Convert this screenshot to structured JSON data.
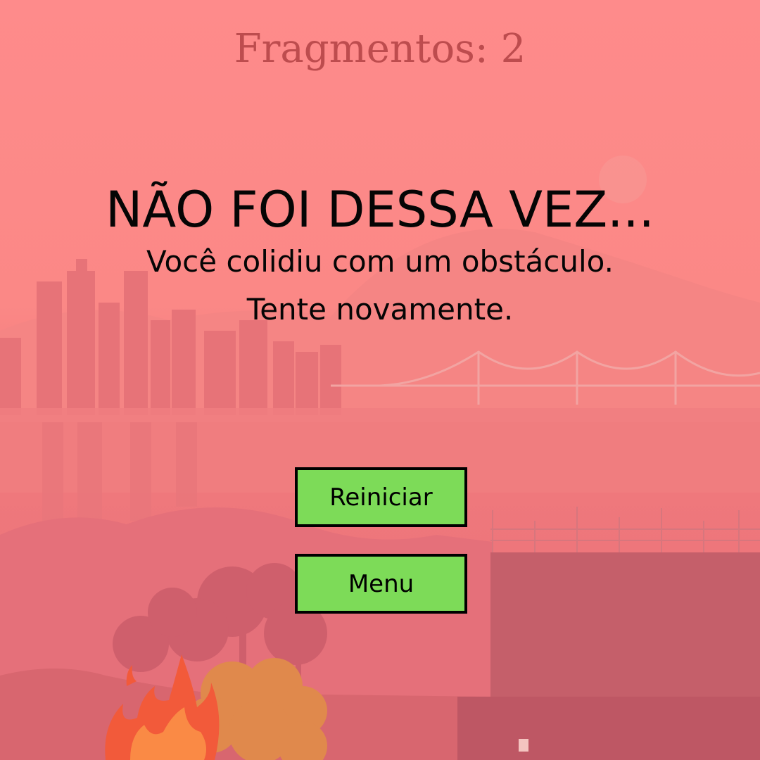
{
  "hud": {
    "fragments_text": "Fragmentos: 2"
  },
  "game_over": {
    "title": "NÃO FOI DESSA VEZ...",
    "message_line1": "Você colidiu com um obstáculo.",
    "message_line2": "Tente novamente."
  },
  "buttons": {
    "restart_label": "Reiniciar",
    "menu_label": "Menu"
  },
  "colors": {
    "sky": "#fe8b8b",
    "fragments_text": "#bd4c4e",
    "button_fill": "#7ddb58",
    "button_border": "#000000",
    "fire": "#f25a3a",
    "bush": "#e0894c"
  }
}
